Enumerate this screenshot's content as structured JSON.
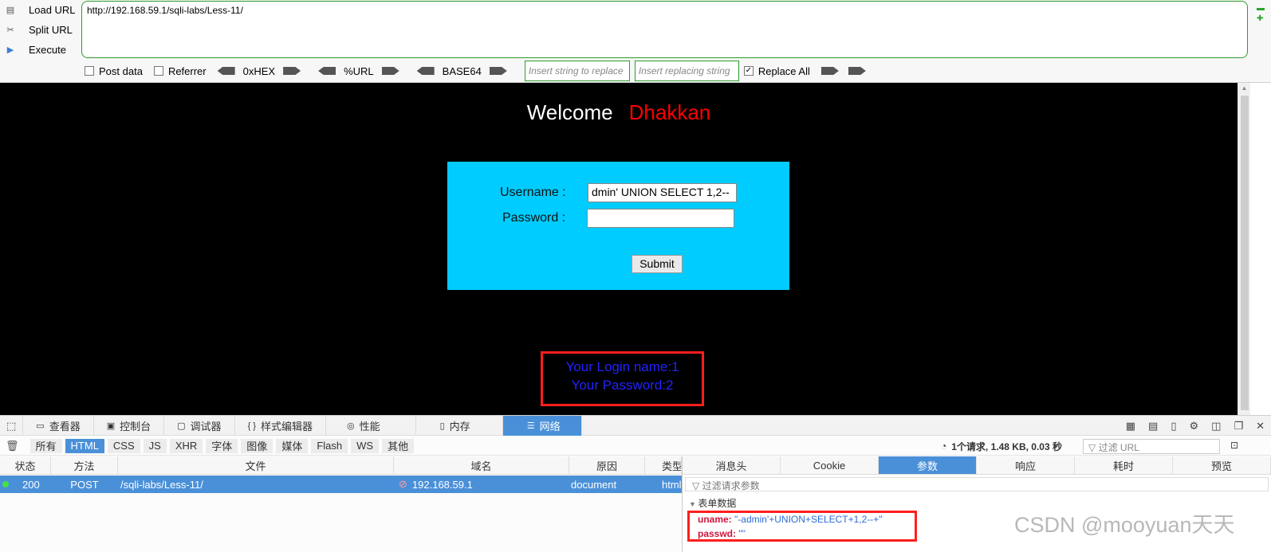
{
  "hackbar": {
    "load_url": "Load URL",
    "split_url": "Split URL",
    "execute": "Execute",
    "url": "http://192.168.59.1/sqli-labs/Less-11/",
    "post_data": "Post data",
    "referrer": "Referrer",
    "hex": "0xHEX",
    "urlenc": "%URL",
    "base64": "BASE64",
    "replace_placeholder": "Insert string to replace",
    "replacing_placeholder": "Insert replacing string",
    "replace_all": "Replace All"
  },
  "page": {
    "welcome": "Welcome",
    "name": "Dhakkan",
    "username_label": "Username :",
    "username_value": "dmin' UNION SELECT 1,2--",
    "password_label": "Password :",
    "password_value": "",
    "submit": "Submit",
    "result_line1": "Your Login name:1",
    "result_line2": "Your Password:2"
  },
  "devtools": {
    "tabs": [
      "查看器",
      "控制台",
      "调试器",
      "样式编辑器",
      "性能",
      "内存",
      "网络"
    ],
    "filters": [
      "所有",
      "HTML",
      "CSS",
      "JS",
      "XHR",
      "字体",
      "图像",
      "媒体",
      "Flash",
      "WS",
      "其他"
    ],
    "stats": "1个请求, 1.48 KB, 0.03 秒",
    "url_filter_placeholder": "过滤 URL",
    "columns": [
      "状态",
      "方法",
      "文件",
      "域名",
      "原因",
      "类型"
    ],
    "row": {
      "status": "200",
      "method": "POST",
      "file": "/sqli-labs/Less-11/",
      "domain": "192.168.59.1",
      "cause": "document",
      "type": "html"
    },
    "side_tabs": [
      "消息头",
      "Cookie",
      "参数",
      "响应",
      "耗时",
      "预览"
    ],
    "params_filter_placeholder": "过滤请求参数",
    "section": "表单数据",
    "params": [
      {
        "key": "uname:",
        "value": "\"-admin'+UNION+SELECT+1,2--+\""
      },
      {
        "key": "passwd:",
        "value": "\"\""
      }
    ]
  },
  "watermark": "CSDN @mooyuan天天"
}
